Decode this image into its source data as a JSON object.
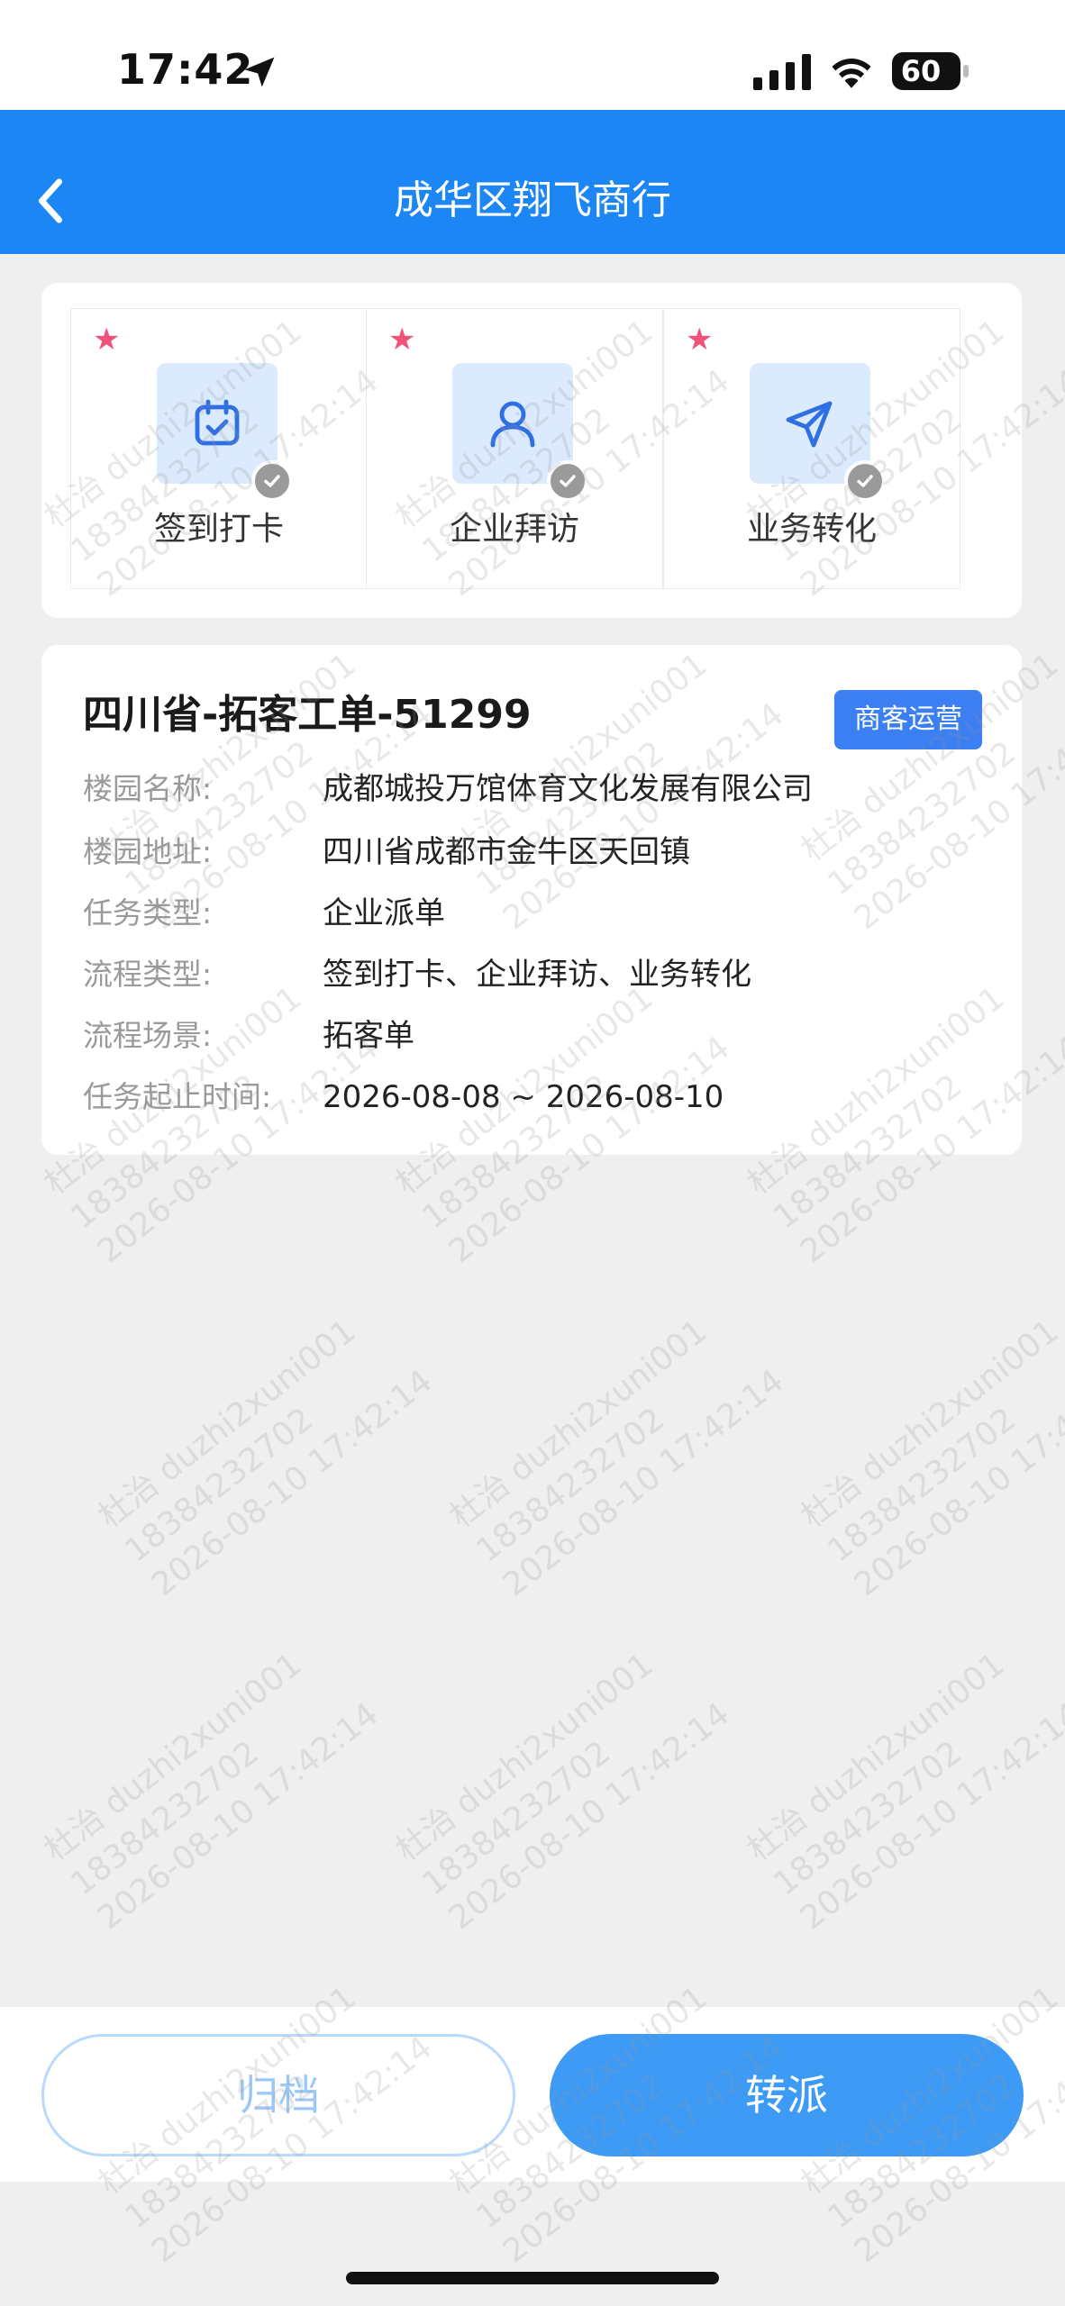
{
  "status_bar": {
    "time": "17:42",
    "battery": "60"
  },
  "nav": {
    "title": "成华区翔飞商行",
    "back_icon": "chevron-left-icon"
  },
  "flow_steps": [
    {
      "label": "签到打卡",
      "icon": "calendar-check-icon",
      "completed": true
    },
    {
      "label": "企业拜访",
      "icon": "person-icon",
      "completed": true
    },
    {
      "label": "业务转化",
      "icon": "paper-plane-icon",
      "completed": true
    }
  ],
  "card": {
    "title": "四川省-拓客工单-51299",
    "tag": "商客运营",
    "rows": [
      {
        "key": "楼园名称:",
        "value": "成都城投万馆体育文化发展有限公司"
      },
      {
        "key": "楼园地址:",
        "value": "四川省成都市金牛区天回镇"
      },
      {
        "key": "任务类型:",
        "value": "企业派单"
      },
      {
        "key": "流程类型:",
        "value": "签到打卡、企业拜访、业务转化"
      },
      {
        "key": "流程场景:",
        "value": "拓客单"
      },
      {
        "key": "任务起止时间:",
        "value": "2026-08-08 ~ 2026-08-10"
      }
    ]
  },
  "buttons": {
    "archive": "归档",
    "transfer": "转派"
  },
  "watermark": {
    "name": "杜治",
    "account": "duzhi2xuni001",
    "phone": "18384232702",
    "datetime": "2026-08-10 17:42:14"
  },
  "colors": {
    "primary": "#1d86f5",
    "button": "#3d9bf6",
    "tag": "#3b7ff2",
    "star": "#f0527a"
  }
}
